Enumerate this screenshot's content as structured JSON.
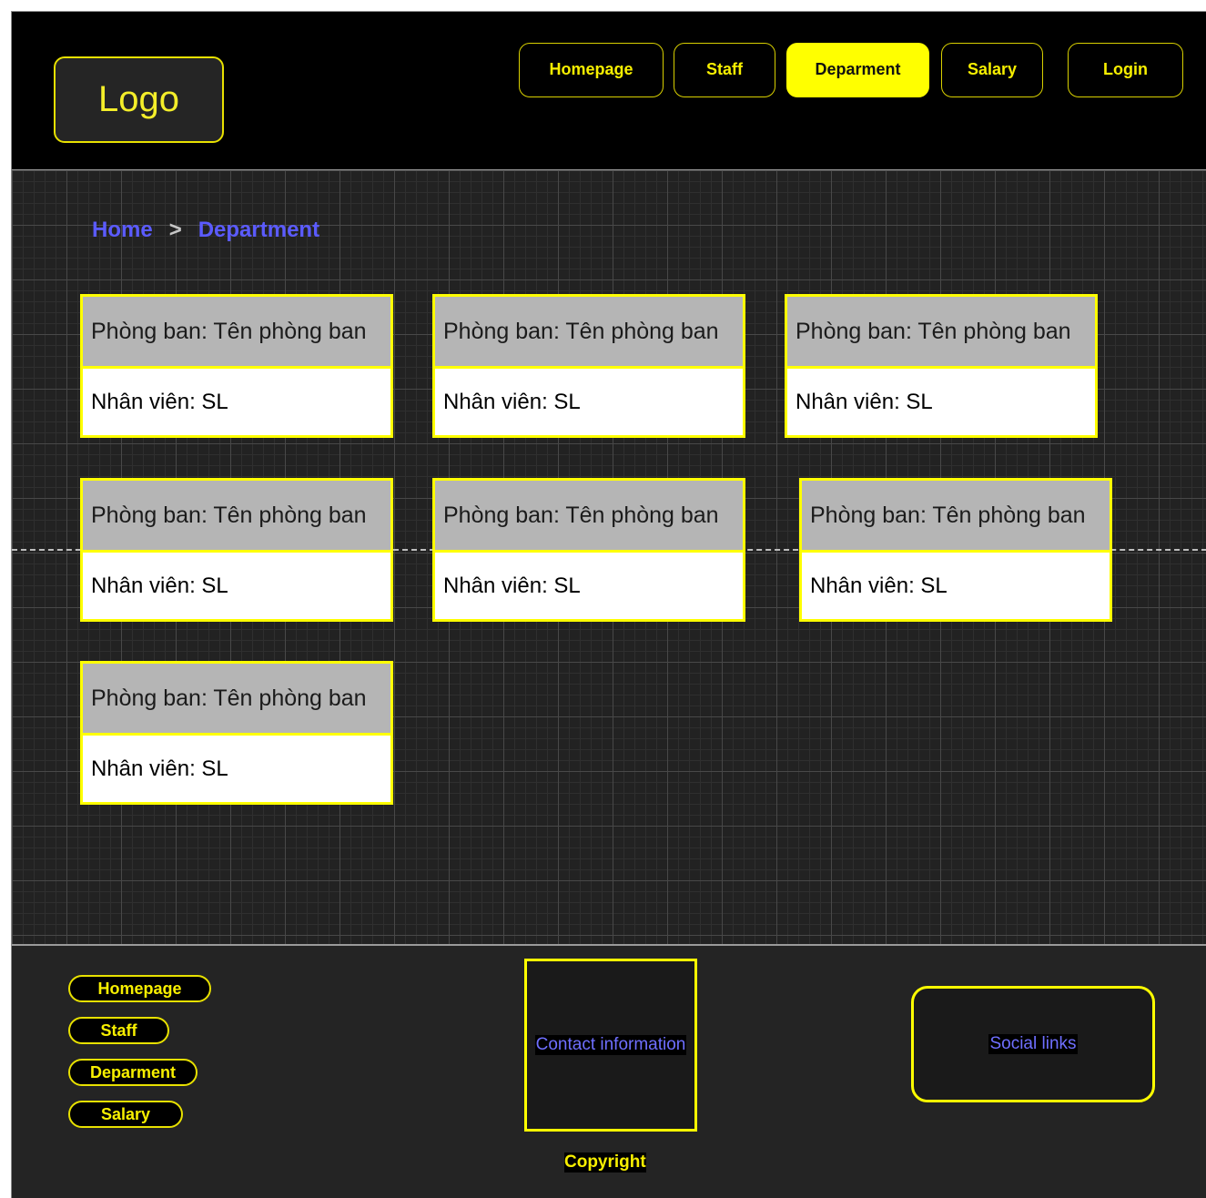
{
  "header": {
    "logo": "Logo",
    "nav": [
      {
        "label": "Homepage"
      },
      {
        "label": "Staff"
      },
      {
        "label": "Deparment",
        "active": true
      },
      {
        "label": "Salary"
      },
      {
        "label": "Login"
      }
    ]
  },
  "breadcrumb": {
    "home": "Home",
    "separator": ">",
    "current": "Department"
  },
  "departments": [
    {
      "title": "Phòng ban: Tên phòng ban",
      "staff": "Nhân viên: SL"
    },
    {
      "title": "Phòng ban: Tên phòng ban",
      "staff": "Nhân viên: SL"
    },
    {
      "title": "Phòng ban: Tên phòng ban",
      "staff": "Nhân viên: SL"
    },
    {
      "title": "Phòng ban: Tên phòng ban",
      "staff": "Nhân viên: SL"
    },
    {
      "title": "Phòng ban: Tên phòng ban",
      "staff": "Nhân viên: SL"
    },
    {
      "title": "Phòng ban: Tên phòng ban",
      "staff": "Nhân viên: SL"
    },
    {
      "title": "Phòng ban: Tên phòng ban",
      "staff": "Nhân viên: SL"
    }
  ],
  "footer": {
    "links": [
      {
        "label": "Homepage"
      },
      {
        "label": "Staff"
      },
      {
        "label": "Deparment"
      },
      {
        "label": "Salary"
      }
    ],
    "contact": "Contact information",
    "social": "Social links",
    "copyright": "Copyright"
  },
  "colors": {
    "accent": "#ffff00",
    "link": "#5b5bff",
    "header_bg": "#000000",
    "body_bg": "#222222"
  }
}
